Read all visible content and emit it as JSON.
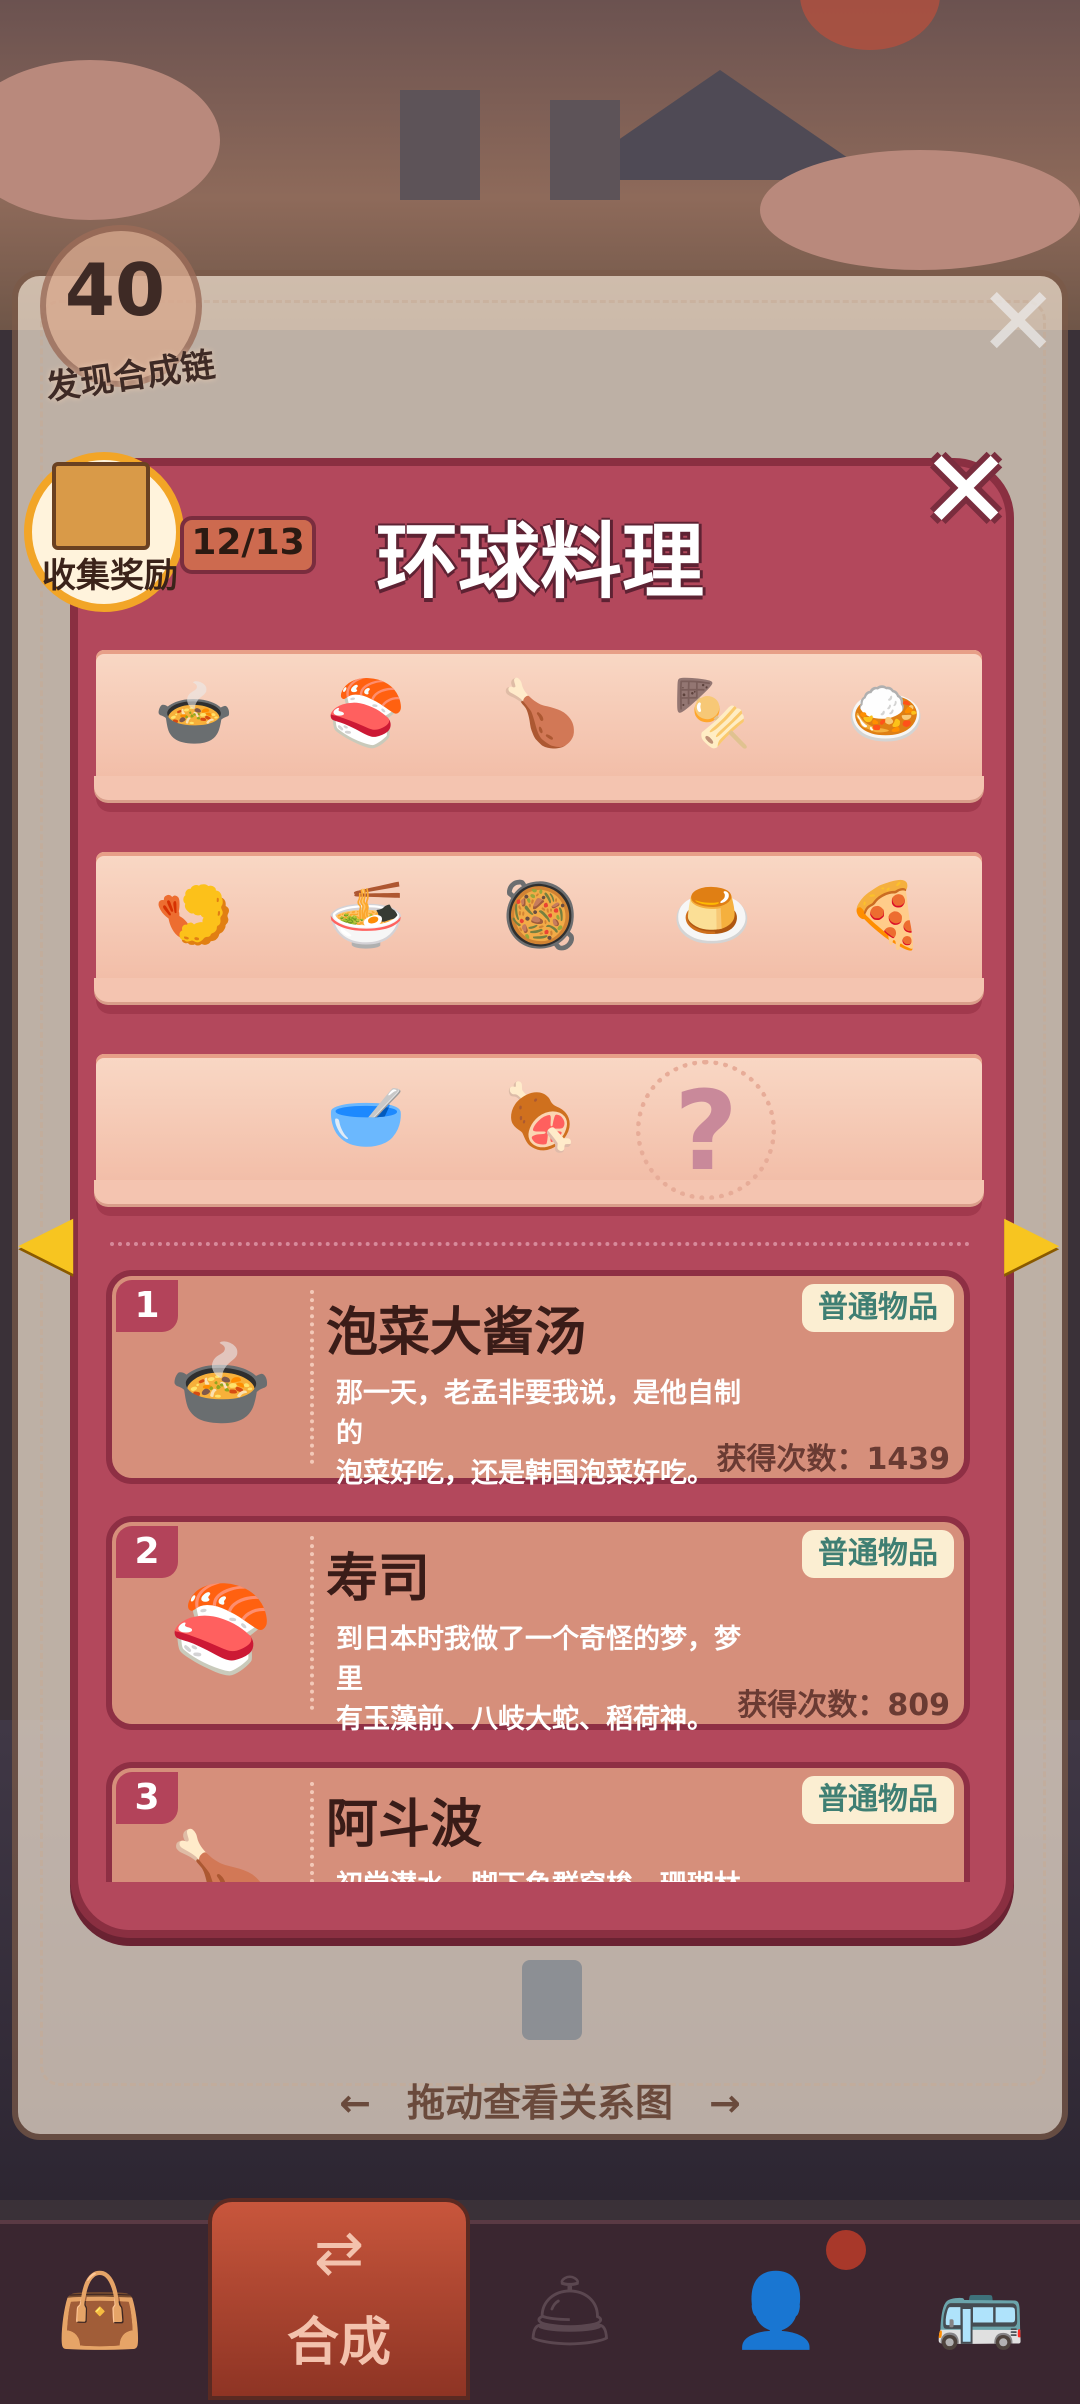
{
  "background": {
    "chain_count": "40",
    "chain_label": "发现合成链",
    "drag_hint": "拖动查看关系图",
    "drag_left_icon": "arrow-left-icon",
    "drag_right_icon": "arrow-right-icon"
  },
  "modal": {
    "title": "环球料理",
    "reward_label": "收集奖励",
    "progress": "12/13",
    "shelves": [
      [
        "kimchi-stew-pot-icon",
        "sushi-roll-icon",
        "roast-chicken-icon",
        "skewers-icon",
        "curry-plate-icon"
      ],
      [
        "shrimp-tempura-bowl-icon",
        "noodle-bowl-icon",
        "braised-pork-icon",
        "pudding-cups-icon",
        "pizza-icon"
      ],
      [
        "green-curry-icon",
        "grilled-dish-icon",
        "unknown-dish-icon"
      ]
    ],
    "mystery_glyph": "?",
    "nav_left_glyph": "◀",
    "nav_right_glyph": "▶"
  },
  "items": [
    {
      "num": "1",
      "name": "泡菜大酱汤",
      "tag": "普通物品",
      "desc_line1": "那一天，老孟非要我说，是他自制的",
      "desc_line2": "泡菜好吃，还是韩国泡菜好吃。",
      "count": "获得次数：1439",
      "icon": "kimchi-stew-pot-icon"
    },
    {
      "num": "2",
      "name": "寿司",
      "tag": "普通物品",
      "desc_line1": "到日本时我做了一个奇怪的梦，梦里",
      "desc_line2": "有玉藻前、八岐大蛇、稻荷神。",
      "count": "获得次数：809",
      "icon": "sushi-roll-icon"
    },
    {
      "num": "3",
      "name": "阿斗波",
      "tag": "普通物品",
      "desc_line1": "初尝潜水，脚下鱼群穿梭，珊瑚林立",
      "desc_line2": "",
      "count": "",
      "icon": "roast-chicken-icon"
    }
  ],
  "bottom_nav": {
    "active_label": "合成",
    "items": [
      "bag-icon",
      "merge-icon",
      "service-bell-icon",
      "chef-icon",
      "bus-icon"
    ]
  },
  "colors": {
    "modal_bg": "#b3485c",
    "modal_border": "#8a2f41",
    "card_bg": "#d68f7b",
    "tag_text": "#3f7f73",
    "arrow": "#f7c520"
  }
}
